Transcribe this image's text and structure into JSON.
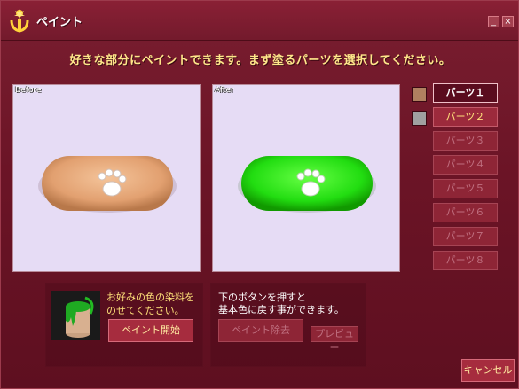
{
  "window": {
    "title": "ペイント",
    "minimize_label": "_",
    "close_label": "×",
    "accent": "#7a1e30"
  },
  "instruction": "好きな部分にペイントできます。まず塗るパーツを選択してください。",
  "previews": {
    "before_label": "Before",
    "after_label": "After",
    "before_color": "#e8a878",
    "after_color": "#33dd22"
  },
  "swatches": [
    {
      "color": "#b08060"
    },
    {
      "color": "#a0a0a0"
    }
  ],
  "parts": [
    {
      "label": "パーツ１",
      "state": "active"
    },
    {
      "label": "パーツ２",
      "state": "enabled"
    },
    {
      "label": "パーツ３",
      "state": "disabled"
    },
    {
      "label": "パーツ４",
      "state": "disabled"
    },
    {
      "label": "パーツ５",
      "state": "disabled"
    },
    {
      "label": "パーツ６",
      "state": "disabled"
    },
    {
      "label": "パーツ７",
      "state": "disabled"
    },
    {
      "label": "パーツ８",
      "state": "disabled"
    }
  ],
  "paint_panel": {
    "text_line1": "お好みの色の染料を",
    "text_line2": "のせてください。",
    "start_button": "ペイント開始"
  },
  "remove_panel": {
    "text_line1": "下のボタンを押すと",
    "text_line2": "基本色に戻す事ができます。",
    "remove_button": "ペイント除去",
    "preview_button": "プレビュー"
  },
  "cancel_button": "キャンセル"
}
